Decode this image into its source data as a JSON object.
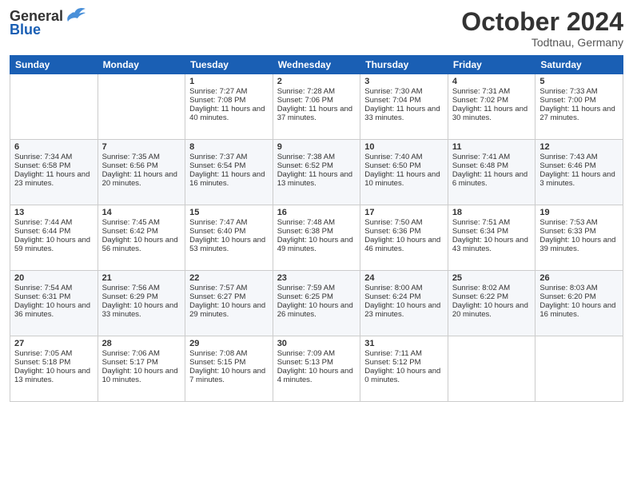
{
  "header": {
    "logo_general": "General",
    "logo_blue": "Blue",
    "month_title": "October 2024",
    "location": "Todtnau, Germany"
  },
  "days_of_week": [
    "Sunday",
    "Monday",
    "Tuesday",
    "Wednesday",
    "Thursday",
    "Friday",
    "Saturday"
  ],
  "weeks": [
    [
      {
        "day": "",
        "sunrise": "",
        "sunset": "",
        "daylight": ""
      },
      {
        "day": "",
        "sunrise": "",
        "sunset": "",
        "daylight": ""
      },
      {
        "day": "1",
        "sunrise": "Sunrise: 7:27 AM",
        "sunset": "Sunset: 7:08 PM",
        "daylight": "Daylight: 11 hours and 40 minutes."
      },
      {
        "day": "2",
        "sunrise": "Sunrise: 7:28 AM",
        "sunset": "Sunset: 7:06 PM",
        "daylight": "Daylight: 11 hours and 37 minutes."
      },
      {
        "day": "3",
        "sunrise": "Sunrise: 7:30 AM",
        "sunset": "Sunset: 7:04 PM",
        "daylight": "Daylight: 11 hours and 33 minutes."
      },
      {
        "day": "4",
        "sunrise": "Sunrise: 7:31 AM",
        "sunset": "Sunset: 7:02 PM",
        "daylight": "Daylight: 11 hours and 30 minutes."
      },
      {
        "day": "5",
        "sunrise": "Sunrise: 7:33 AM",
        "sunset": "Sunset: 7:00 PM",
        "daylight": "Daylight: 11 hours and 27 minutes."
      }
    ],
    [
      {
        "day": "6",
        "sunrise": "Sunrise: 7:34 AM",
        "sunset": "Sunset: 6:58 PM",
        "daylight": "Daylight: 11 hours and 23 minutes."
      },
      {
        "day": "7",
        "sunrise": "Sunrise: 7:35 AM",
        "sunset": "Sunset: 6:56 PM",
        "daylight": "Daylight: 11 hours and 20 minutes."
      },
      {
        "day": "8",
        "sunrise": "Sunrise: 7:37 AM",
        "sunset": "Sunset: 6:54 PM",
        "daylight": "Daylight: 11 hours and 16 minutes."
      },
      {
        "day": "9",
        "sunrise": "Sunrise: 7:38 AM",
        "sunset": "Sunset: 6:52 PM",
        "daylight": "Daylight: 11 hours and 13 minutes."
      },
      {
        "day": "10",
        "sunrise": "Sunrise: 7:40 AM",
        "sunset": "Sunset: 6:50 PM",
        "daylight": "Daylight: 11 hours and 10 minutes."
      },
      {
        "day": "11",
        "sunrise": "Sunrise: 7:41 AM",
        "sunset": "Sunset: 6:48 PM",
        "daylight": "Daylight: 11 hours and 6 minutes."
      },
      {
        "day": "12",
        "sunrise": "Sunrise: 7:43 AM",
        "sunset": "Sunset: 6:46 PM",
        "daylight": "Daylight: 11 hours and 3 minutes."
      }
    ],
    [
      {
        "day": "13",
        "sunrise": "Sunrise: 7:44 AM",
        "sunset": "Sunset: 6:44 PM",
        "daylight": "Daylight: 10 hours and 59 minutes."
      },
      {
        "day": "14",
        "sunrise": "Sunrise: 7:45 AM",
        "sunset": "Sunset: 6:42 PM",
        "daylight": "Daylight: 10 hours and 56 minutes."
      },
      {
        "day": "15",
        "sunrise": "Sunrise: 7:47 AM",
        "sunset": "Sunset: 6:40 PM",
        "daylight": "Daylight: 10 hours and 53 minutes."
      },
      {
        "day": "16",
        "sunrise": "Sunrise: 7:48 AM",
        "sunset": "Sunset: 6:38 PM",
        "daylight": "Daylight: 10 hours and 49 minutes."
      },
      {
        "day": "17",
        "sunrise": "Sunrise: 7:50 AM",
        "sunset": "Sunset: 6:36 PM",
        "daylight": "Daylight: 10 hours and 46 minutes."
      },
      {
        "day": "18",
        "sunrise": "Sunrise: 7:51 AM",
        "sunset": "Sunset: 6:34 PM",
        "daylight": "Daylight: 10 hours and 43 minutes."
      },
      {
        "day": "19",
        "sunrise": "Sunrise: 7:53 AM",
        "sunset": "Sunset: 6:33 PM",
        "daylight": "Daylight: 10 hours and 39 minutes."
      }
    ],
    [
      {
        "day": "20",
        "sunrise": "Sunrise: 7:54 AM",
        "sunset": "Sunset: 6:31 PM",
        "daylight": "Daylight: 10 hours and 36 minutes."
      },
      {
        "day": "21",
        "sunrise": "Sunrise: 7:56 AM",
        "sunset": "Sunset: 6:29 PM",
        "daylight": "Daylight: 10 hours and 33 minutes."
      },
      {
        "day": "22",
        "sunrise": "Sunrise: 7:57 AM",
        "sunset": "Sunset: 6:27 PM",
        "daylight": "Daylight: 10 hours and 29 minutes."
      },
      {
        "day": "23",
        "sunrise": "Sunrise: 7:59 AM",
        "sunset": "Sunset: 6:25 PM",
        "daylight": "Daylight: 10 hours and 26 minutes."
      },
      {
        "day": "24",
        "sunrise": "Sunrise: 8:00 AM",
        "sunset": "Sunset: 6:24 PM",
        "daylight": "Daylight: 10 hours and 23 minutes."
      },
      {
        "day": "25",
        "sunrise": "Sunrise: 8:02 AM",
        "sunset": "Sunset: 6:22 PM",
        "daylight": "Daylight: 10 hours and 20 minutes."
      },
      {
        "day": "26",
        "sunrise": "Sunrise: 8:03 AM",
        "sunset": "Sunset: 6:20 PM",
        "daylight": "Daylight: 10 hours and 16 minutes."
      }
    ],
    [
      {
        "day": "27",
        "sunrise": "Sunrise: 7:05 AM",
        "sunset": "Sunset: 5:18 PM",
        "daylight": "Daylight: 10 hours and 13 minutes."
      },
      {
        "day": "28",
        "sunrise": "Sunrise: 7:06 AM",
        "sunset": "Sunset: 5:17 PM",
        "daylight": "Daylight: 10 hours and 10 minutes."
      },
      {
        "day": "29",
        "sunrise": "Sunrise: 7:08 AM",
        "sunset": "Sunset: 5:15 PM",
        "daylight": "Daylight: 10 hours and 7 minutes."
      },
      {
        "day": "30",
        "sunrise": "Sunrise: 7:09 AM",
        "sunset": "Sunset: 5:13 PM",
        "daylight": "Daylight: 10 hours and 4 minutes."
      },
      {
        "day": "31",
        "sunrise": "Sunrise: 7:11 AM",
        "sunset": "Sunset: 5:12 PM",
        "daylight": "Daylight: 10 hours and 0 minutes."
      },
      {
        "day": "",
        "sunrise": "",
        "sunset": "",
        "daylight": ""
      },
      {
        "day": "",
        "sunrise": "",
        "sunset": "",
        "daylight": ""
      }
    ]
  ]
}
